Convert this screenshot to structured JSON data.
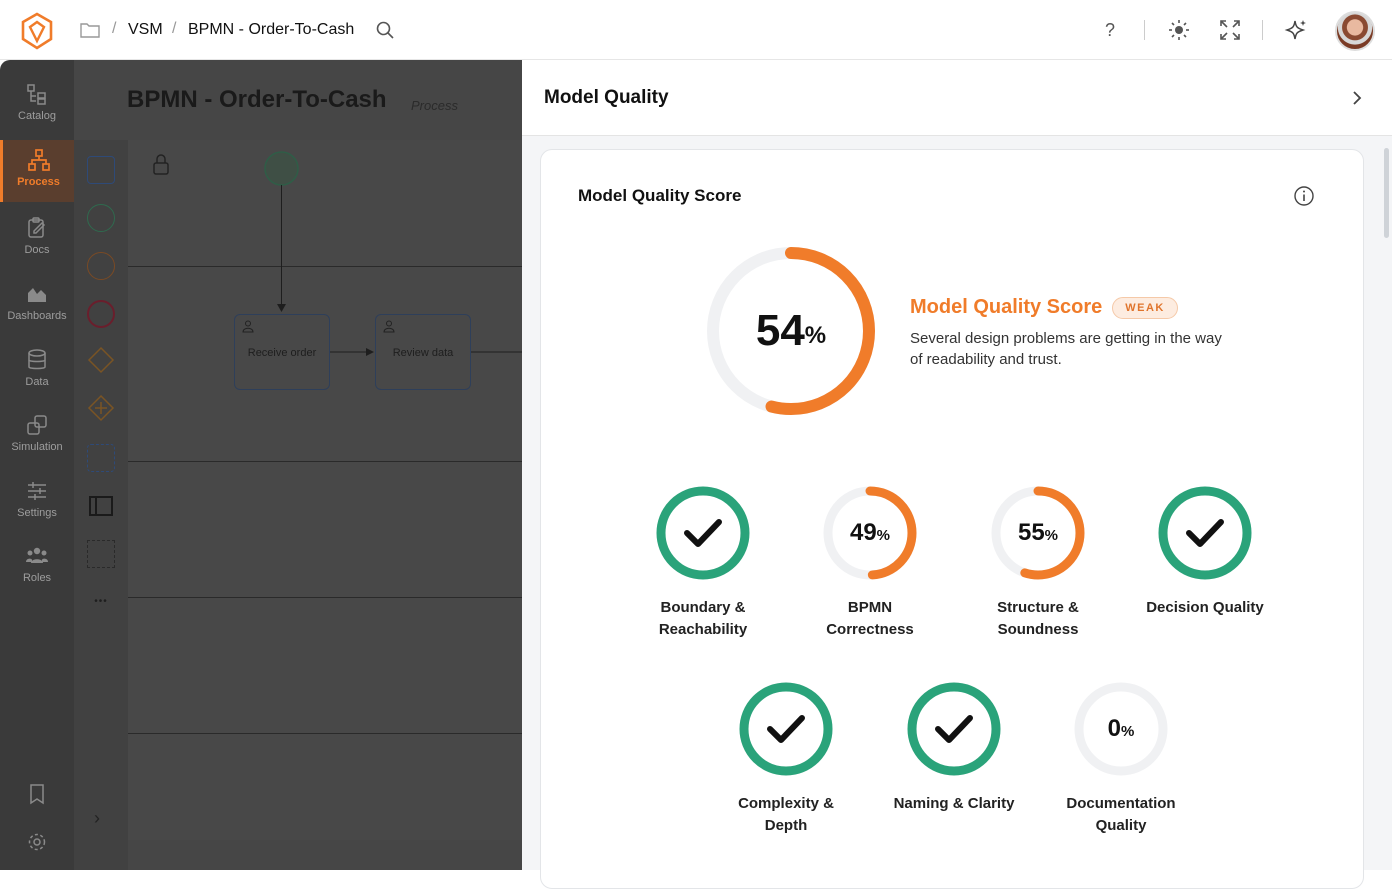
{
  "topbar": {
    "breadcrumb": [
      "VSM",
      "BPMN - Order-To-Cash"
    ],
    "icons": [
      "app-logo-icon",
      "folder-icon",
      "search-icon",
      "help-icon",
      "theme-sun-icon",
      "fullscreen-icon",
      "ai-sparkle-icon",
      "user-avatar"
    ],
    "help_glyph": "?"
  },
  "leftnav": {
    "items": [
      {
        "label": "Catalog",
        "icon": "catalog-icon"
      },
      {
        "label": "Process",
        "icon": "process-icon",
        "active": true
      },
      {
        "label": "Docs",
        "icon": "docs-icon"
      },
      {
        "label": "Dashboards",
        "icon": "dashboards-icon"
      },
      {
        "label": "Data",
        "icon": "data-icon"
      },
      {
        "label": "Simulation",
        "icon": "simulation-icon"
      },
      {
        "label": "Settings",
        "icon": "settings-sliders-icon"
      },
      {
        "label": "Roles",
        "icon": "roles-icon"
      }
    ],
    "bottom_icons": [
      "bookmark-icon",
      "gear-icon"
    ],
    "accent": "#f07c2a"
  },
  "canvas": {
    "title": "BPMN - Order-To-Cash",
    "subtitle": "Process",
    "tasks": [
      "Receive order",
      "Review data"
    ],
    "more_glyph": "•••",
    "expand_glyph": "›"
  },
  "panel": {
    "title": "Model Quality",
    "card_title": "Model Quality Score",
    "overall": {
      "value": "54",
      "unit": "%",
      "fraction": 0.54,
      "label": "Model Quality Score",
      "badge": "WEAK",
      "description": "Several design problems are getting in the way of readability and trust."
    },
    "metrics": [
      {
        "name": "Boundary & Reachability",
        "line1": "Boundary &",
        "line2": "Reachability",
        "state": "check",
        "fraction": 1.0
      },
      {
        "name": "BPMN Correctness",
        "line1": "BPMN",
        "line2": "Correctness",
        "state": "percent",
        "value": "49",
        "unit": "%",
        "fraction": 0.49
      },
      {
        "name": "Structure & Soundness",
        "line1": "Structure &",
        "line2": "Soundness",
        "state": "percent",
        "value": "55",
        "unit": "%",
        "fraction": 0.55
      },
      {
        "name": "Decision Quality",
        "line1": "Decision Quality",
        "line2": "",
        "state": "check",
        "fraction": 1.0
      },
      {
        "name": "Complexity & Depth",
        "line1": "Complexity &",
        "line2": "Depth",
        "state": "check",
        "fraction": 1.0
      },
      {
        "name": "Naming & Clarity",
        "line1": "Naming & Clarity",
        "line2": "",
        "state": "check",
        "fraction": 1.0
      },
      {
        "name": "Documentation Quality",
        "line1": "Documentation",
        "line2": "Quality",
        "state": "percent",
        "value": "0",
        "unit": "%",
        "fraction": 0.0
      }
    ],
    "colors": {
      "good": "#2aa37a",
      "warn": "#f07c2a",
      "track": "#f0f1f3"
    }
  }
}
